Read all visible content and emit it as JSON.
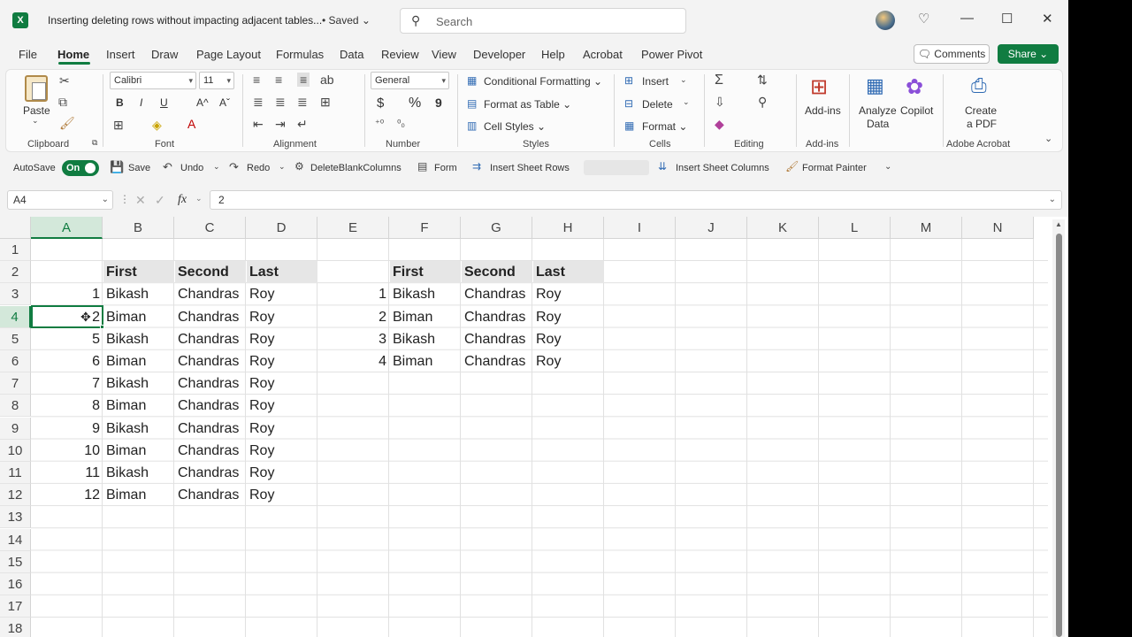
{
  "titlebar": {
    "app_icon": "X",
    "doc_title": "Inserting deleting rows without impacting adjacent tables...",
    "saved_status": "• Saved ⌄",
    "search_placeholder": "Search",
    "minimize": "—",
    "maximize": "☐",
    "close": "✕"
  },
  "menu": {
    "items": [
      "File",
      "Home",
      "Insert",
      "Draw",
      "Page Layout",
      "Formulas",
      "Data",
      "Review",
      "View",
      "Developer",
      "Help",
      "Acrobat",
      "Power Pivot"
    ],
    "active": "Home",
    "comments": "Comments",
    "share": "Share ⌄"
  },
  "ribbon": {
    "clipboard": {
      "paste": "Paste",
      "group": "Clipboard"
    },
    "font": {
      "name": "Calibri",
      "size": "11",
      "bold": "B",
      "italic": "I",
      "underline": "U",
      "grow": "A^",
      "shrink": "Aˇ",
      "group": "Font"
    },
    "alignment": {
      "group": "Alignment"
    },
    "number": {
      "format": "General",
      "currency": "$",
      "percent": "%",
      "comma": "9",
      "group": "Number"
    },
    "styles": {
      "conditional": "Conditional Formatting ⌄",
      "format_table": "Format as Table ⌄",
      "cell_styles": "Cell Styles ⌄",
      "group": "Styles"
    },
    "cells": {
      "insert": "Insert",
      "delete": "Delete",
      "format": "Format ⌄",
      "group": "Cells"
    },
    "editing": {
      "group": "Editing"
    },
    "addins": {
      "label": "Add-ins",
      "group": "Add-ins"
    },
    "analyze": {
      "line1": "Analyze",
      "line2": "Data"
    },
    "copilot": {
      "label": "Copilot"
    },
    "acrobat": {
      "line1": "Create",
      "line2": "a PDF",
      "group": "Adobe Acrobat"
    }
  },
  "qat": {
    "autosave": "AutoSave",
    "toggle": "On",
    "save": "Save",
    "undo": "Undo",
    "redo": "Redo",
    "delete_blank": "DeleteBlankColumns",
    "form": "Form",
    "insert_rows": "Insert Sheet Rows",
    "insert_cols": "Insert Sheet Columns",
    "format_painter": "Format Painter"
  },
  "formula_bar": {
    "name_box": "A4",
    "fx": "fx",
    "value": "2"
  },
  "sheet": {
    "columns": [
      "A",
      "B",
      "C",
      "D",
      "E",
      "F",
      "G",
      "H",
      "I",
      "J",
      "K",
      "L",
      "M",
      "N"
    ],
    "rows": [
      "1",
      "2",
      "3",
      "4",
      "5",
      "6",
      "7",
      "8",
      "9",
      "10",
      "11",
      "12",
      "13",
      "14",
      "15",
      "16",
      "17",
      "18"
    ],
    "selected_column": "A",
    "selected_row": "4",
    "table1": {
      "headers": [
        "First",
        "Second",
        "Last"
      ],
      "rows": [
        [
          "1",
          "Bikash",
          "Chandras",
          "Roy"
        ],
        [
          "2",
          "Biman",
          "Chandras",
          "Roy"
        ],
        [
          "5",
          "Bikash",
          "Chandras",
          "Roy"
        ],
        [
          "6",
          "Biman",
          "Chandras",
          "Roy"
        ],
        [
          "7",
          "Bikash",
          "Chandras",
          "Roy"
        ],
        [
          "8",
          "Biman",
          "Chandras",
          "Roy"
        ],
        [
          "9",
          "Bikash",
          "Chandras",
          "Roy"
        ],
        [
          "10",
          "Biman",
          "Chandras",
          "Roy"
        ],
        [
          "11",
          "Bikash",
          "Chandras",
          "Roy"
        ],
        [
          "12",
          "Biman",
          "Chandras",
          "Roy"
        ]
      ]
    },
    "table2": {
      "headers": [
        "First",
        "Second",
        "Last"
      ],
      "rows": [
        [
          "1",
          "Bikash",
          "Chandras",
          "Roy"
        ],
        [
          "2",
          "Biman",
          "Chandras",
          "Roy"
        ],
        [
          "3",
          "Bikash",
          "Chandras",
          "Roy"
        ],
        [
          "4",
          "Biman",
          "Chandras",
          "Roy"
        ]
      ]
    }
  },
  "colors": {
    "accent": "#107c41",
    "header_fill": "#e6e6e6"
  }
}
